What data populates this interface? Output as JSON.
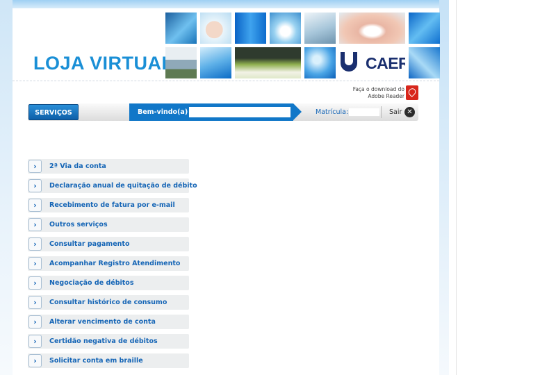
{
  "header": {
    "logo_text": "LOJA VIRTUAL",
    "brand": "CAER",
    "download_line1": "Faça o download do",
    "download_line2": "Adobe Reader"
  },
  "nav": {
    "services_label": "SERVIÇOS",
    "welcome_label": "Bem-vindo(a)",
    "matricula_label": "Matrícula:",
    "logout_label": "Sair"
  },
  "menu": {
    "items": [
      {
        "label": "2ª Via da conta"
      },
      {
        "label": "Declaração anual de quitação de débito"
      },
      {
        "label": "Recebimento de fatura por e-mail"
      },
      {
        "label": "Outros serviços"
      },
      {
        "label": "Consultar pagamento"
      },
      {
        "label": "Acompanhar Registro Atendimento"
      },
      {
        "label": "Negociação de débitos"
      },
      {
        "label": "Consultar histórico de consumo"
      },
      {
        "label": "Alterar vencimento de conta"
      },
      {
        "label": "Certidão negativa de débitos"
      },
      {
        "label": "Solicitar conta em braille"
      }
    ]
  },
  "colors": {
    "accent": "#1177c8",
    "link": "#1565b6",
    "logo": "#1a8fd6",
    "brand_navy": "#1a2f6f"
  },
  "icons": {
    "menu_arrow": "chevron-right-icon",
    "pdf": "adobe-pdf-icon",
    "logout": "close-icon"
  }
}
